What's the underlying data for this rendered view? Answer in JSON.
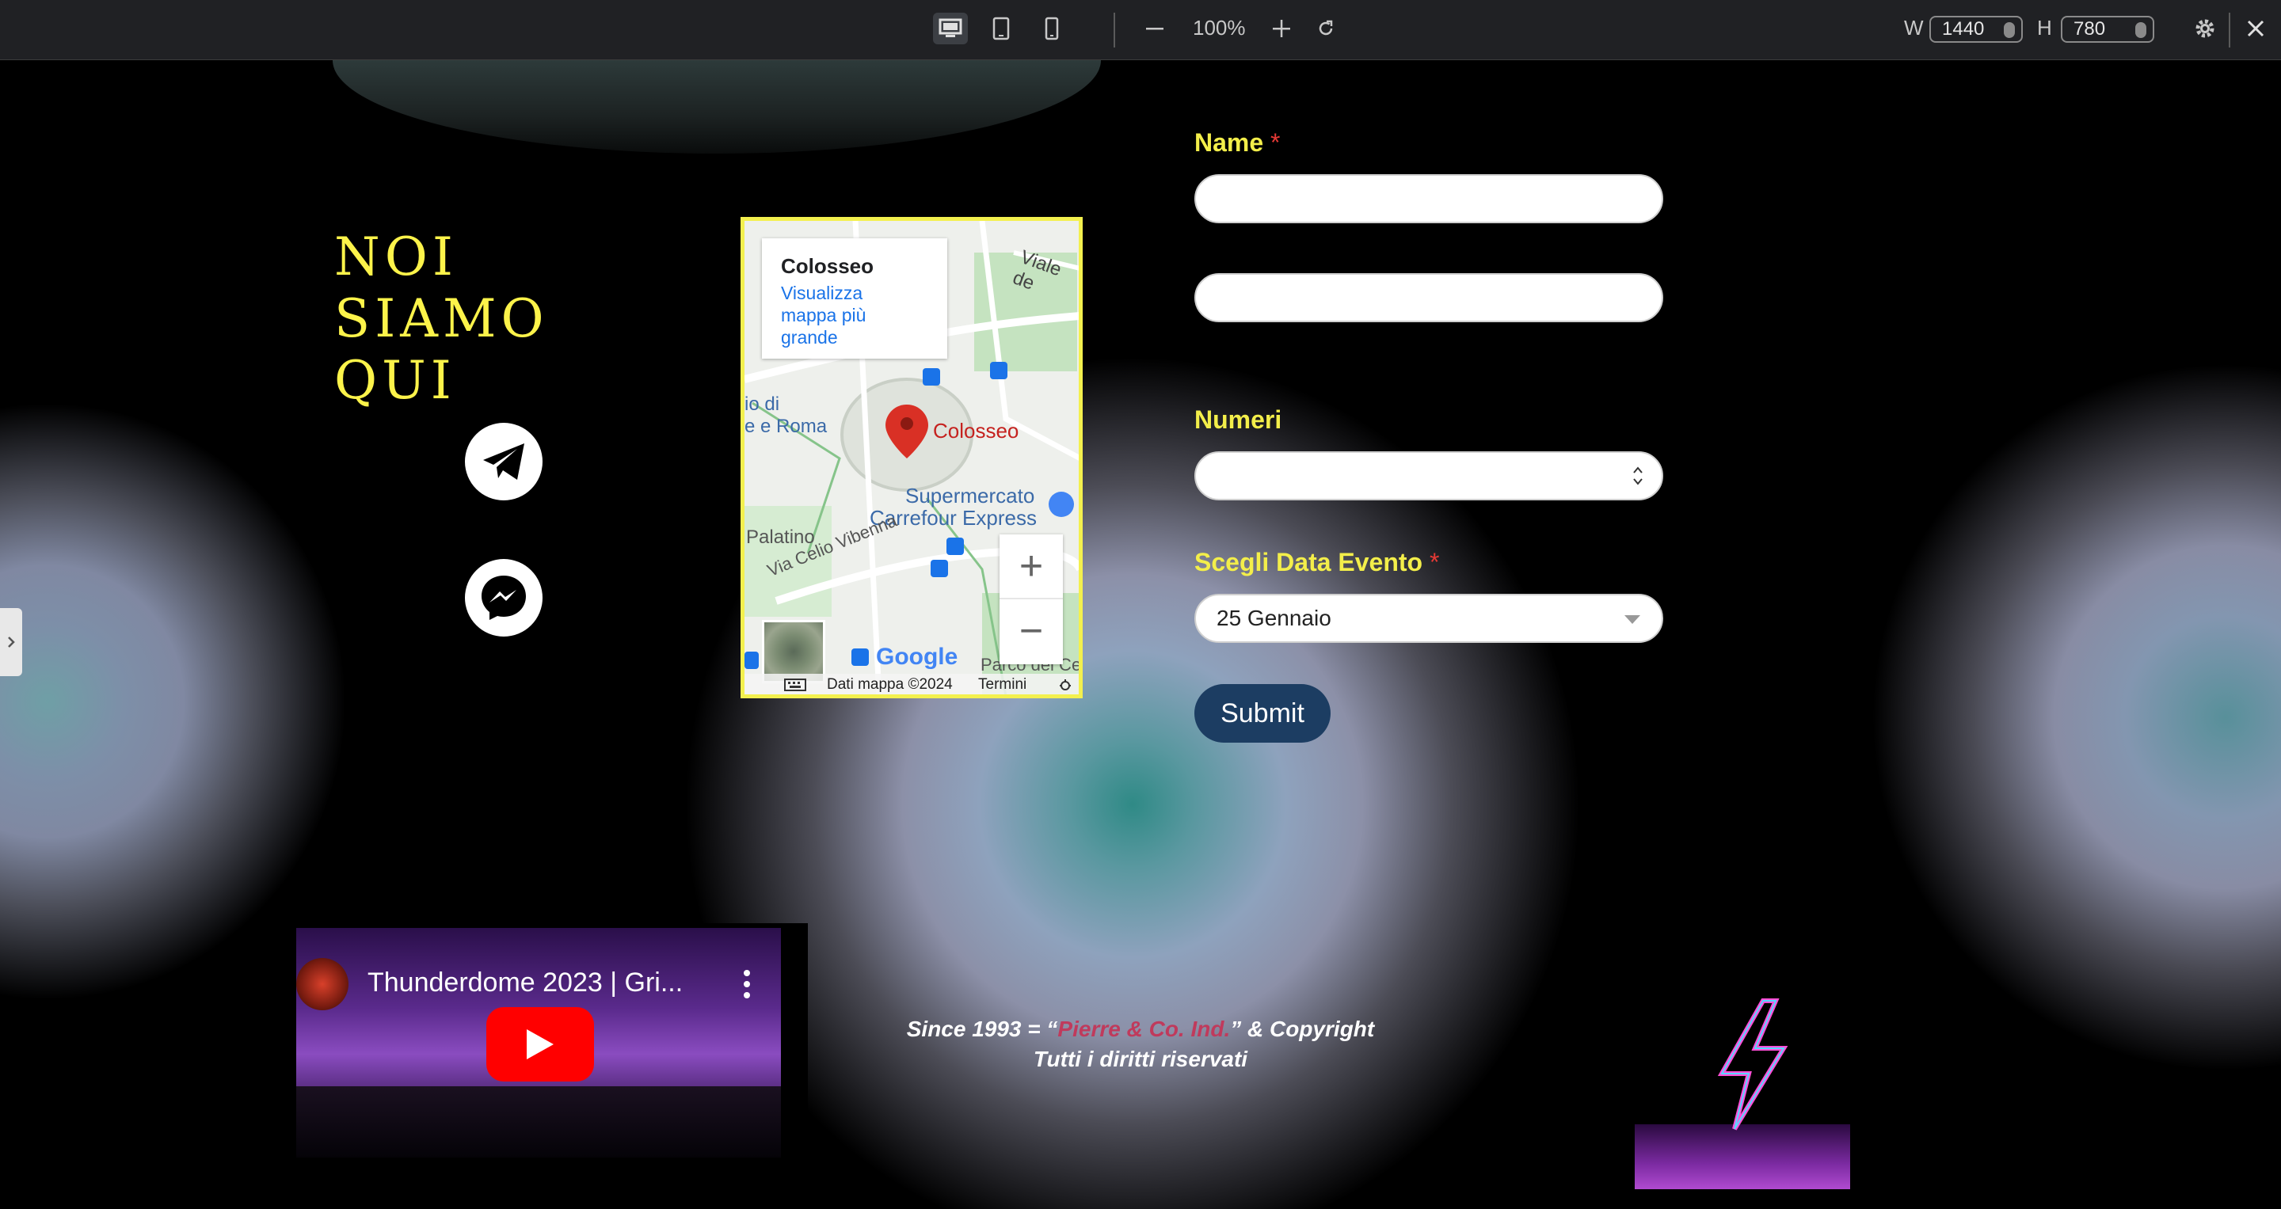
{
  "toolbar": {
    "zoom": "100%",
    "width_label": "W",
    "width_value": "1440",
    "height_label": "H",
    "height_value": "780"
  },
  "page": {
    "title_line1": "NOI SIAMO",
    "title_line2": "QUI"
  },
  "map": {
    "place_title": "Colosseo",
    "link_line1": "Visualizza",
    "link_line2": "mappa più",
    "link_line3": "grande",
    "pin_label": "Colosseo",
    "poi_super1": "Supermercato",
    "poi_super2": "Carrefour Express",
    "street_vibenna": "Via Celio Vibenna",
    "street_viale": "Viale de",
    "area_palatino": "Palatino",
    "area_roma1": "io di",
    "area_roma2": "e e Roma",
    "area_parco": "Parco del Celio",
    "google": "Google",
    "attribution": "Dati mappa ©2024",
    "terms": "Termini",
    "zoom_in": "+",
    "zoom_out": "−"
  },
  "form": {
    "name_label": "Name",
    "required_mark": "*",
    "numeri_label": "Numeri",
    "data_label": "Scegli Data Evento",
    "select_value": "25 Gennaio",
    "submit": "Submit"
  },
  "video": {
    "title": "Thunderdome 2023 | Gri..."
  },
  "footer": {
    "line1_pre": "Since 1993 = “",
    "brand": "Pierre & Co. Ind.",
    "line1_post": "” & Copyright",
    "line2": "Tutti i diritti riservati"
  },
  "colors": {
    "accent_yellow": "#f3ee4a",
    "submit_blue": "#1c3d62",
    "brand_red": "#c03a5c"
  }
}
